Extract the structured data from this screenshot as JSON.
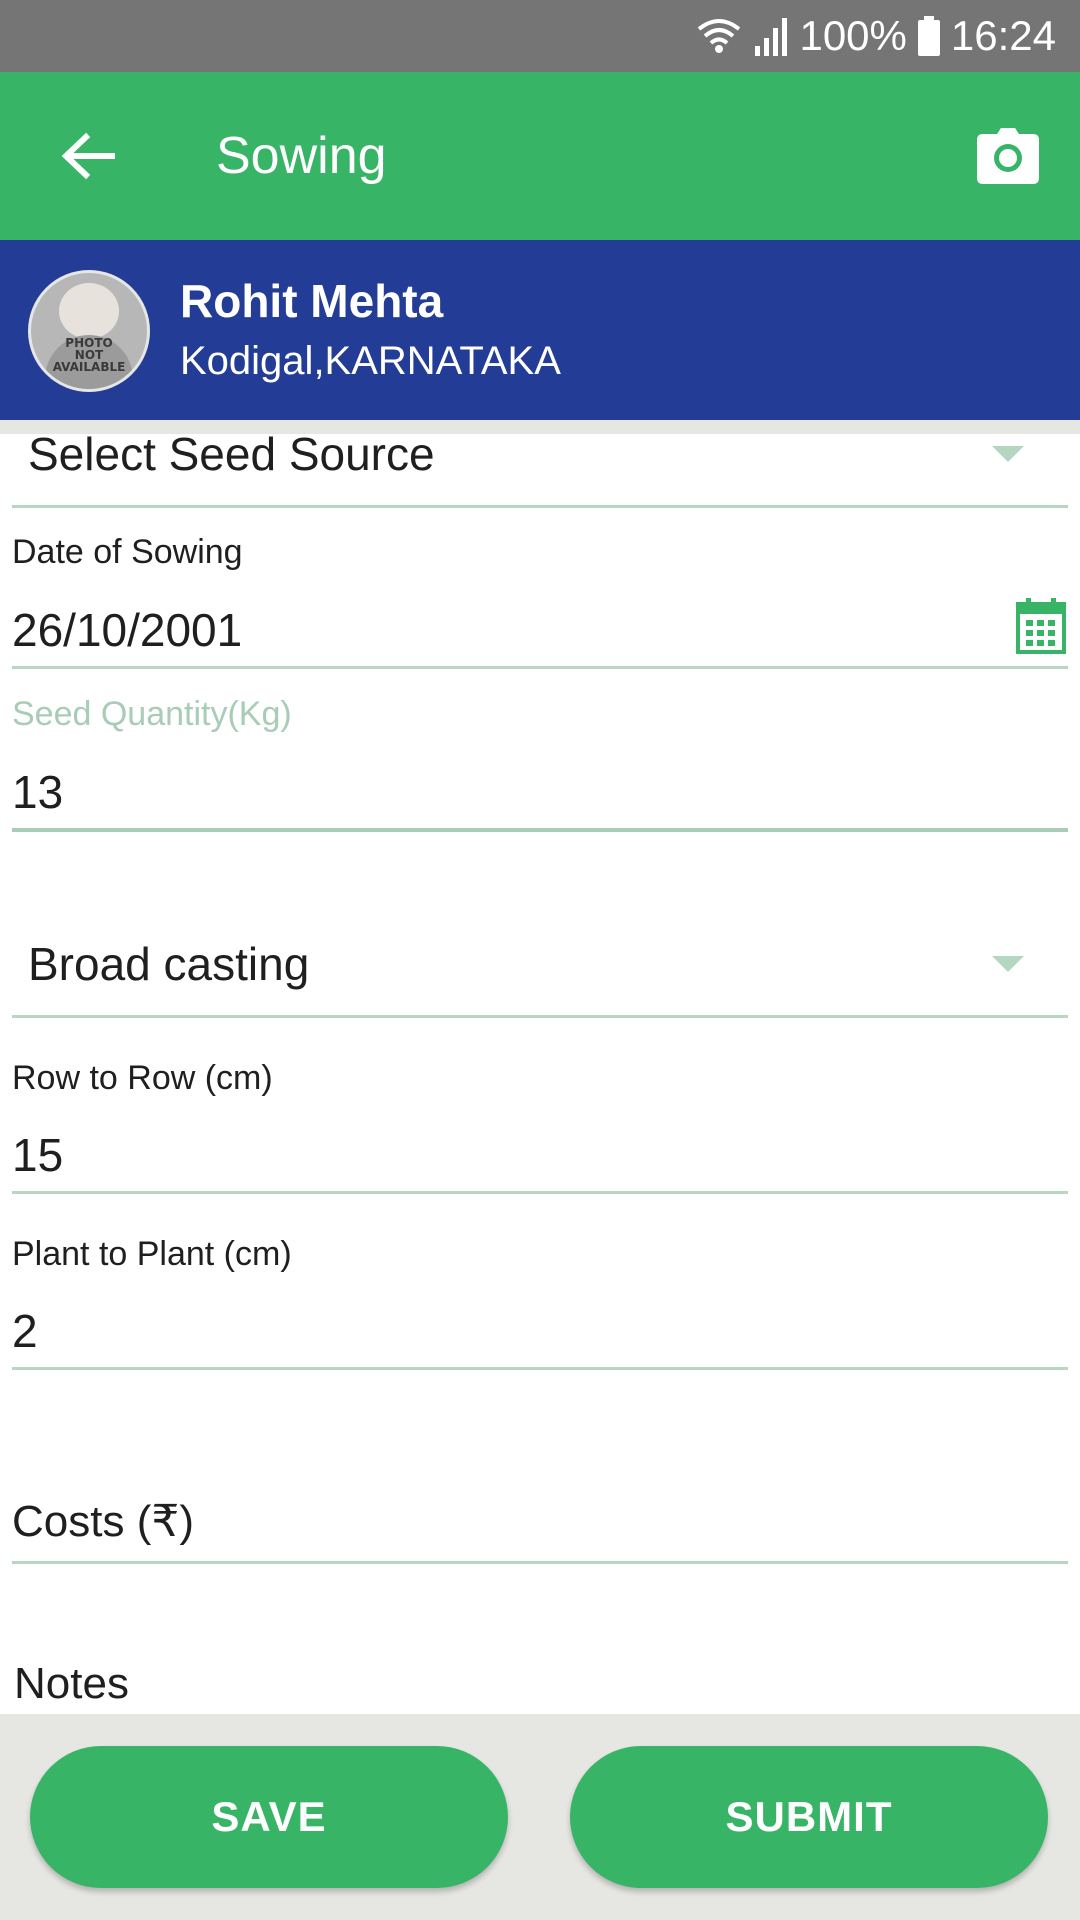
{
  "status_bar": {
    "battery": "100%",
    "time": "16:24",
    "icons": [
      "wifi-icon",
      "signal-icon",
      "battery-icon"
    ]
  },
  "app_bar": {
    "title": "Sowing",
    "back_icon": "arrow-left-icon",
    "camera_icon": "camera-icon",
    "color": "#38b467"
  },
  "profile": {
    "name": "Rohit Mehta",
    "location": "Kodigal,KARNATAKA",
    "avatar_text": [
      "PHOTO",
      "NOT",
      "AVAILABLE"
    ],
    "color": "#233c96"
  },
  "form": {
    "seed_source": {
      "selected": "Select Seed Source"
    },
    "date_of_sowing": {
      "label": "Date of Sowing",
      "value": "26/10/2001",
      "icon": "calendar-icon"
    },
    "seed_quantity": {
      "label": "Seed Quantity(Kg)",
      "value": "13"
    },
    "sowing_method": {
      "selected": "Broad casting"
    },
    "row_to_row": {
      "label": "Row to Row (cm)",
      "value": "15"
    },
    "plant_to_plant": {
      "label": "Plant to Plant (cm)",
      "value": "2"
    },
    "costs": {
      "placeholder": "Costs (₹)"
    },
    "notes": {
      "placeholder": "Notes"
    }
  },
  "actions": {
    "save_label": "SAVE",
    "submit_label": "SUBMIT"
  }
}
